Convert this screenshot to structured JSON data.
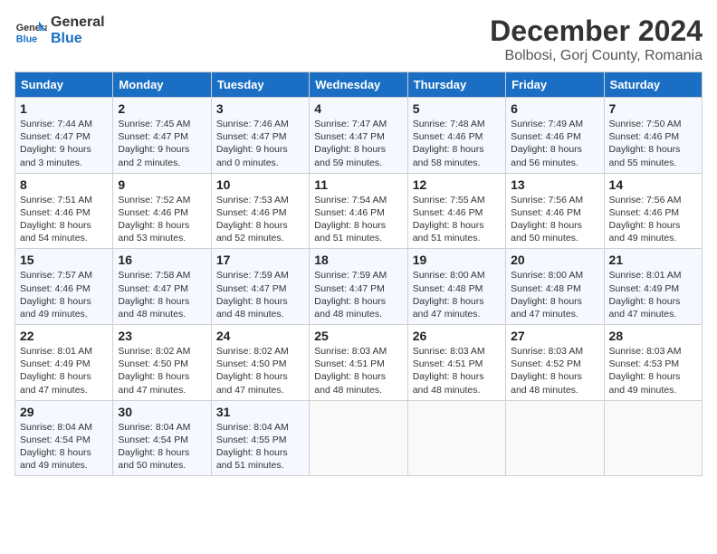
{
  "header": {
    "logo_line1": "General",
    "logo_line2": "Blue",
    "month": "December 2024",
    "location": "Bolbosi, Gorj County, Romania"
  },
  "weekdays": [
    "Sunday",
    "Monday",
    "Tuesday",
    "Wednesday",
    "Thursday",
    "Friday",
    "Saturday"
  ],
  "weeks": [
    [
      {
        "day": "1",
        "sunrise": "Sunrise: 7:44 AM",
        "sunset": "Sunset: 4:47 PM",
        "daylight": "Daylight: 9 hours and 3 minutes."
      },
      {
        "day": "2",
        "sunrise": "Sunrise: 7:45 AM",
        "sunset": "Sunset: 4:47 PM",
        "daylight": "Daylight: 9 hours and 2 minutes."
      },
      {
        "day": "3",
        "sunrise": "Sunrise: 7:46 AM",
        "sunset": "Sunset: 4:47 PM",
        "daylight": "Daylight: 9 hours and 0 minutes."
      },
      {
        "day": "4",
        "sunrise": "Sunrise: 7:47 AM",
        "sunset": "Sunset: 4:47 PM",
        "daylight": "Daylight: 8 hours and 59 minutes."
      },
      {
        "day": "5",
        "sunrise": "Sunrise: 7:48 AM",
        "sunset": "Sunset: 4:46 PM",
        "daylight": "Daylight: 8 hours and 58 minutes."
      },
      {
        "day": "6",
        "sunrise": "Sunrise: 7:49 AM",
        "sunset": "Sunset: 4:46 PM",
        "daylight": "Daylight: 8 hours and 56 minutes."
      },
      {
        "day": "7",
        "sunrise": "Sunrise: 7:50 AM",
        "sunset": "Sunset: 4:46 PM",
        "daylight": "Daylight: 8 hours and 55 minutes."
      }
    ],
    [
      {
        "day": "8",
        "sunrise": "Sunrise: 7:51 AM",
        "sunset": "Sunset: 4:46 PM",
        "daylight": "Daylight: 8 hours and 54 minutes."
      },
      {
        "day": "9",
        "sunrise": "Sunrise: 7:52 AM",
        "sunset": "Sunset: 4:46 PM",
        "daylight": "Daylight: 8 hours and 53 minutes."
      },
      {
        "day": "10",
        "sunrise": "Sunrise: 7:53 AM",
        "sunset": "Sunset: 4:46 PM",
        "daylight": "Daylight: 8 hours and 52 minutes."
      },
      {
        "day": "11",
        "sunrise": "Sunrise: 7:54 AM",
        "sunset": "Sunset: 4:46 PM",
        "daylight": "Daylight: 8 hours and 51 minutes."
      },
      {
        "day": "12",
        "sunrise": "Sunrise: 7:55 AM",
        "sunset": "Sunset: 4:46 PM",
        "daylight": "Daylight: 8 hours and 51 minutes."
      },
      {
        "day": "13",
        "sunrise": "Sunrise: 7:56 AM",
        "sunset": "Sunset: 4:46 PM",
        "daylight": "Daylight: 8 hours and 50 minutes."
      },
      {
        "day": "14",
        "sunrise": "Sunrise: 7:56 AM",
        "sunset": "Sunset: 4:46 PM",
        "daylight": "Daylight: 8 hours and 49 minutes."
      }
    ],
    [
      {
        "day": "15",
        "sunrise": "Sunrise: 7:57 AM",
        "sunset": "Sunset: 4:46 PM",
        "daylight": "Daylight: 8 hours and 49 minutes."
      },
      {
        "day": "16",
        "sunrise": "Sunrise: 7:58 AM",
        "sunset": "Sunset: 4:47 PM",
        "daylight": "Daylight: 8 hours and 48 minutes."
      },
      {
        "day": "17",
        "sunrise": "Sunrise: 7:59 AM",
        "sunset": "Sunset: 4:47 PM",
        "daylight": "Daylight: 8 hours and 48 minutes."
      },
      {
        "day": "18",
        "sunrise": "Sunrise: 7:59 AM",
        "sunset": "Sunset: 4:47 PM",
        "daylight": "Daylight: 8 hours and 48 minutes."
      },
      {
        "day": "19",
        "sunrise": "Sunrise: 8:00 AM",
        "sunset": "Sunset: 4:48 PM",
        "daylight": "Daylight: 8 hours and 47 minutes."
      },
      {
        "day": "20",
        "sunrise": "Sunrise: 8:00 AM",
        "sunset": "Sunset: 4:48 PM",
        "daylight": "Daylight: 8 hours and 47 minutes."
      },
      {
        "day": "21",
        "sunrise": "Sunrise: 8:01 AM",
        "sunset": "Sunset: 4:49 PM",
        "daylight": "Daylight: 8 hours and 47 minutes."
      }
    ],
    [
      {
        "day": "22",
        "sunrise": "Sunrise: 8:01 AM",
        "sunset": "Sunset: 4:49 PM",
        "daylight": "Daylight: 8 hours and 47 minutes."
      },
      {
        "day": "23",
        "sunrise": "Sunrise: 8:02 AM",
        "sunset": "Sunset: 4:50 PM",
        "daylight": "Daylight: 8 hours and 47 minutes."
      },
      {
        "day": "24",
        "sunrise": "Sunrise: 8:02 AM",
        "sunset": "Sunset: 4:50 PM",
        "daylight": "Daylight: 8 hours and 47 minutes."
      },
      {
        "day": "25",
        "sunrise": "Sunrise: 8:03 AM",
        "sunset": "Sunset: 4:51 PM",
        "daylight": "Daylight: 8 hours and 48 minutes."
      },
      {
        "day": "26",
        "sunrise": "Sunrise: 8:03 AM",
        "sunset": "Sunset: 4:51 PM",
        "daylight": "Daylight: 8 hours and 48 minutes."
      },
      {
        "day": "27",
        "sunrise": "Sunrise: 8:03 AM",
        "sunset": "Sunset: 4:52 PM",
        "daylight": "Daylight: 8 hours and 48 minutes."
      },
      {
        "day": "28",
        "sunrise": "Sunrise: 8:03 AM",
        "sunset": "Sunset: 4:53 PM",
        "daylight": "Daylight: 8 hours and 49 minutes."
      }
    ],
    [
      {
        "day": "29",
        "sunrise": "Sunrise: 8:04 AM",
        "sunset": "Sunset: 4:54 PM",
        "daylight": "Daylight: 8 hours and 49 minutes."
      },
      {
        "day": "30",
        "sunrise": "Sunrise: 8:04 AM",
        "sunset": "Sunset: 4:54 PM",
        "daylight": "Daylight: 8 hours and 50 minutes."
      },
      {
        "day": "31",
        "sunrise": "Sunrise: 8:04 AM",
        "sunset": "Sunset: 4:55 PM",
        "daylight": "Daylight: 8 hours and 51 minutes."
      },
      null,
      null,
      null,
      null
    ]
  ]
}
